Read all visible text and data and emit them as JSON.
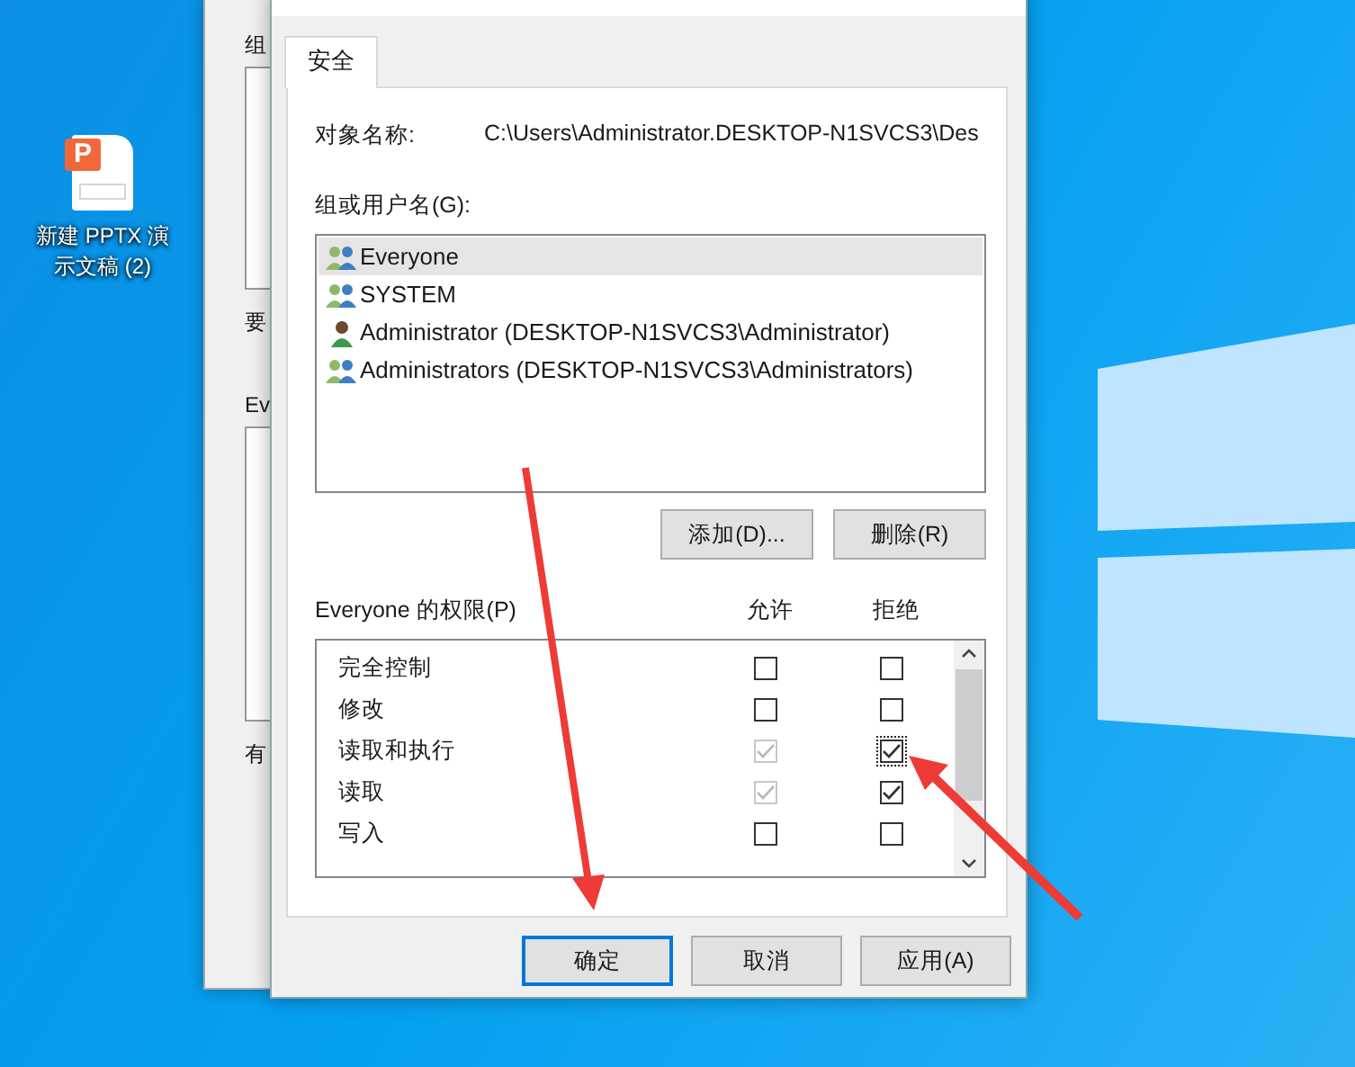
{
  "desktop_icon": {
    "logo_text": "P",
    "label": "新建 PPTX 演示文稿 (2)"
  },
  "back_window": {
    "labels": [
      "组",
      "要",
      "Ev",
      "有"
    ]
  },
  "dialog": {
    "tabs": [
      {
        "label": "安全",
        "selected": true
      }
    ],
    "object_name": {
      "label": "对象名称:",
      "value": "C:\\Users\\Administrator.DESKTOP-N1SVCS3\\Des"
    },
    "groups_label": "组或用户名(G):",
    "groups": [
      {
        "name": "Everyone",
        "kind": "group",
        "selected": true
      },
      {
        "name": "SYSTEM",
        "kind": "group",
        "selected": false
      },
      {
        "name": "Administrator (DESKTOP-N1SVCS3\\Administrator)",
        "kind": "user",
        "selected": false
      },
      {
        "name": "Administrators (DESKTOP-N1SVCS3\\Administrators)",
        "kind": "group",
        "selected": false
      }
    ],
    "group_buttons": [
      "添加(D)...",
      "删除(R)"
    ],
    "permissions": {
      "title": "Everyone 的权限(P)",
      "allow_header": "允许",
      "deny_header": "拒绝",
      "rows": [
        {
          "name": "完全控制",
          "allow": {
            "checked": false,
            "disabled": false
          },
          "deny": {
            "checked": false,
            "disabled": false,
            "focused": false
          }
        },
        {
          "name": "修改",
          "allow": {
            "checked": false,
            "disabled": false
          },
          "deny": {
            "checked": false,
            "disabled": false,
            "focused": false
          }
        },
        {
          "name": "读取和执行",
          "allow": {
            "checked": true,
            "disabled": true
          },
          "deny": {
            "checked": true,
            "disabled": false,
            "focused": true
          }
        },
        {
          "name": "读取",
          "allow": {
            "checked": true,
            "disabled": true
          },
          "deny": {
            "checked": true,
            "disabled": false,
            "focused": false
          }
        },
        {
          "name": "写入",
          "allow": {
            "checked": false,
            "disabled": false
          },
          "deny": {
            "checked": false,
            "disabled": false,
            "focused": false
          }
        }
      ]
    },
    "buttons": [
      {
        "label": "确定",
        "default": true
      },
      {
        "label": "取消",
        "default": false
      },
      {
        "label": "应用(A)",
        "default": false
      }
    ]
  }
}
